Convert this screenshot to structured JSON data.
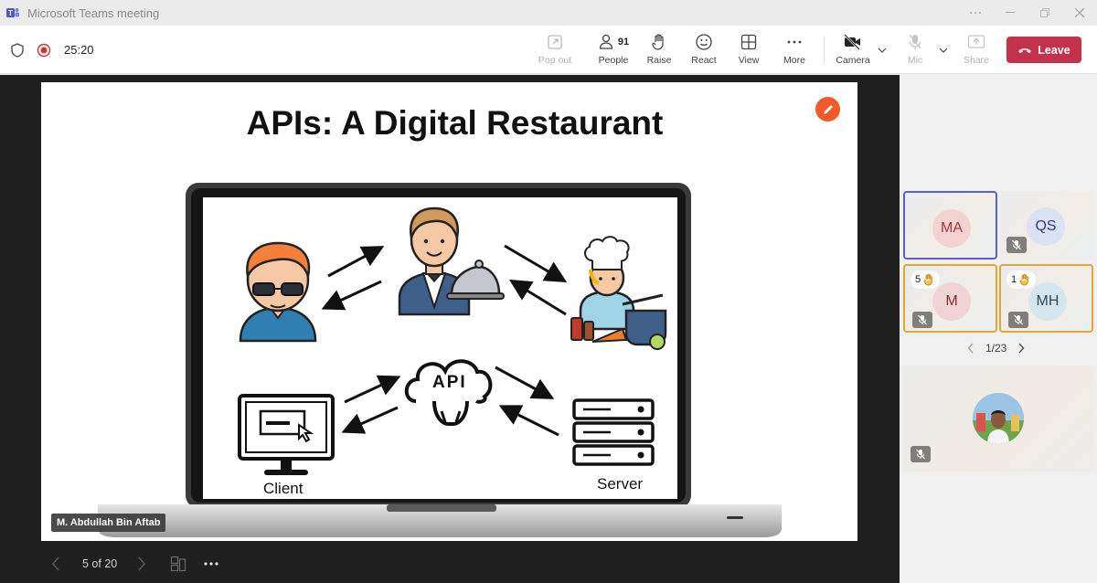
{
  "window": {
    "title": "Microsoft Teams meeting"
  },
  "toolbar": {
    "timer": "25:20",
    "popout_label": "Pop out",
    "people_label": "People",
    "people_count": "91",
    "raise_label": "Raise",
    "react_label": "React",
    "view_label": "View",
    "more_label": "More",
    "camera_label": "Camera",
    "mic_label": "Mic",
    "share_label": "Share",
    "leave_label": "Leave"
  },
  "slide": {
    "title": "APIs: A Digital Restaurant",
    "api_label": "API",
    "client_label": "Client",
    "server_label": "Server",
    "presenter_name": "M. Abdullah Bin Aftab",
    "counter": "5 of 20"
  },
  "participants": [
    {
      "initials": "MA",
      "muted": false,
      "hand": ""
    },
    {
      "initials": "QS",
      "muted": true,
      "hand": ""
    },
    {
      "initials": "M",
      "muted": true,
      "hand": "5"
    },
    {
      "initials": "MH",
      "muted": true,
      "hand": "1"
    }
  ],
  "gallery": {
    "pager": "1/23"
  },
  "colors": {
    "accent": "#5b5fc7",
    "leave": "#c4314b",
    "raised_hand": "#e8a52f",
    "recording": "#d13438",
    "annotation": "#f05a28"
  },
  "icons": [
    "shield-icon",
    "record-icon",
    "popout-icon",
    "people-icon",
    "hand-icon",
    "smiley-icon",
    "grid-icon",
    "ellipsis-icon",
    "camera-off-icon",
    "mic-off-icon",
    "share-icon",
    "phone-icon",
    "pen-icon"
  ]
}
